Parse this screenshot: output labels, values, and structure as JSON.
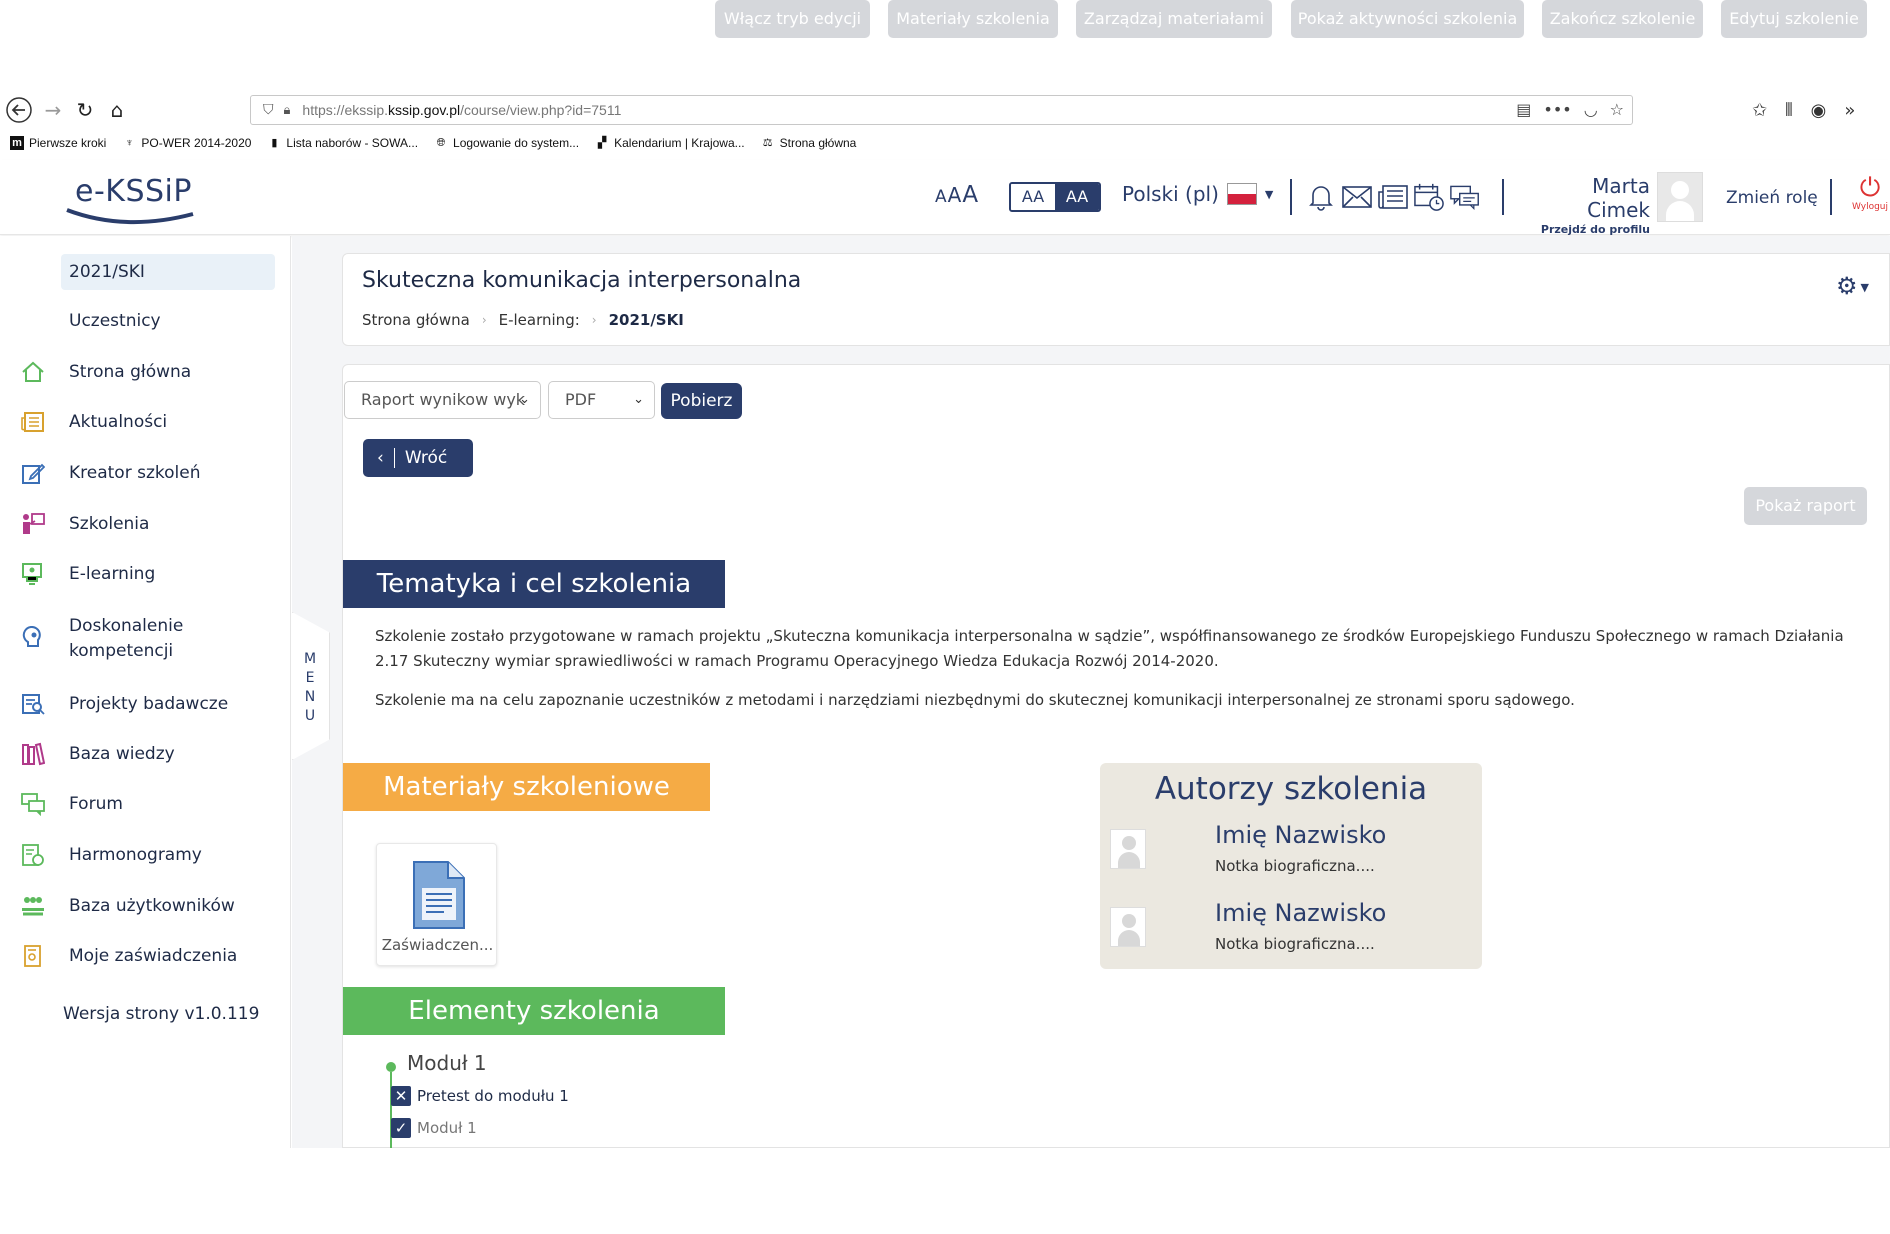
{
  "browser": {
    "url_prefix": "https://ekssip.",
    "url_domain": "kssip.gov.pl",
    "url_path": "/course/view.php?id=7511",
    "bookmarks": [
      "Pierwsze kroki",
      "PO-WER 2014-2020",
      "Lista naborów - SOWA...",
      "Logowanie do system...",
      "Kalendarium | Krajowa...",
      "Strona główna"
    ]
  },
  "header": {
    "logo": "e-KSSiP",
    "font_sizes": [
      "A",
      "A",
      "A"
    ],
    "contrast": [
      "AA",
      "AA"
    ],
    "language": "Polski (pl)",
    "user_name": "Marta Cimek",
    "profile_link": "Przejdź do profilu",
    "change_role": "Zmień rolę",
    "logout": "Wyloguj"
  },
  "sidebar": {
    "active": "2021/SKI",
    "items": [
      {
        "label": "Uczestnicy",
        "icon": ""
      },
      {
        "label": "Strona główna",
        "icon": "home-icon"
      },
      {
        "label": "Aktualności",
        "icon": "news-icon"
      },
      {
        "label": "Kreator szkoleń",
        "icon": "edit-icon"
      },
      {
        "label": "Szkolenia",
        "icon": "training-icon"
      },
      {
        "label": "E-learning",
        "icon": "elearning-icon"
      },
      {
        "label": "Doskonalenie kompetencji",
        "icon": "competence-icon"
      },
      {
        "label": "Projekty badawcze",
        "icon": "research-icon"
      },
      {
        "label": "Baza wiedzy",
        "icon": "books-icon"
      },
      {
        "label": "Forum",
        "icon": "forum-icon"
      },
      {
        "label": "Harmonogramy",
        "icon": "schedule-icon"
      },
      {
        "label": "Baza użytkowników",
        "icon": "users-icon"
      },
      {
        "label": "Moje zaświadczenia",
        "icon": "certificate-icon"
      }
    ],
    "version": "Wersja strony v1.0.119",
    "menu_tab": [
      "M",
      "E",
      "N",
      "U"
    ]
  },
  "course": {
    "title": "Skuteczna komunikacja interpersonalna",
    "breadcrumb": [
      "Strona główna",
      "E-learning:",
      "2021/SKI"
    ]
  },
  "toolbar": {
    "report_select": "Raport wynikow wyk",
    "format_select": "PDF",
    "download": "Pobierz",
    "back": "Wróć",
    "buttons": [
      "Włącz tryb edycji",
      "Materiały szkolenia",
      "Zarządzaj materiałami",
      "Pokaż aktywności szkolenia",
      "Zakończ szkolenie",
      "Edytuj szkolenie",
      "Pokaż raport"
    ]
  },
  "sections": {
    "topic": "Tematyka i cel szkolenia",
    "topic_p1": "Szkolenie zostało przygotowane w ramach projektu „Skuteczna komunikacja interpersonalna w sądzie”, współfinansowanego ze środków Europejskiego Funduszu Społecznego w ramach Działania 2.17 Skuteczny wymiar sprawiedliwości w ramach Programu Operacyjnego Wiedza Edukacja Rozwój 2014-2020.",
    "topic_p2": "Szkolenie ma na celu zapoznanie uczestników z metodami i narzędziami niezbędnymi do skutecznej komunikacji interpersonalnej ze stronami sporu sądowego.",
    "materials": "Materiały szkoleniowe",
    "material_file": "Zaświadczen...",
    "authors_title": "Autorzy szkolenia",
    "authors": [
      {
        "name": "Imię Nazwisko",
        "bio": "Notka biograficzna...."
      },
      {
        "name": "Imię Nazwisko",
        "bio": "Notka biograficzna...."
      }
    ],
    "elements": "Elementy szkolenia",
    "module_title": "Moduł 1",
    "activities": [
      {
        "label": "Pretest do modułu 1",
        "state": "failed"
      },
      {
        "label": "Moduł 1",
        "state": "done"
      }
    ]
  },
  "colors": {
    "navy": "#2a3d6b",
    "orange": "#f5ab45",
    "green": "#5cb95c",
    "disabled": "#d5d7db",
    "authors_bg": "#ebe8e0"
  }
}
